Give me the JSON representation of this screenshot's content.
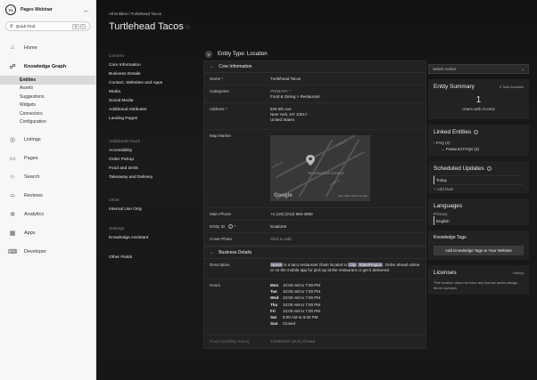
{
  "sidebar": {
    "brand": "Pages Webinar",
    "logo_text": "YX",
    "quick_find": {
      "label": "Quick Find",
      "keys": [
        "⌘",
        "K"
      ]
    },
    "nav": [
      {
        "label": "Home",
        "icon": "home-icon"
      },
      {
        "label": "Knowledge Graph",
        "icon": "graph-icon"
      },
      {
        "label": "Listings",
        "icon": "listings-icon"
      },
      {
        "label": "Pages",
        "icon": "pages-icon"
      },
      {
        "label": "Search",
        "icon": "search-icon"
      },
      {
        "label": "Reviews",
        "icon": "reviews-icon"
      },
      {
        "label": "Analytics",
        "icon": "analytics-icon"
      },
      {
        "label": "Apps",
        "icon": "apps-icon"
      },
      {
        "label": "Developer",
        "icon": "developer-icon"
      }
    ],
    "kg_sub": [
      "Entities",
      "Assets",
      "Suggestions",
      "Widgets",
      "Connectors",
      "Configuration"
    ]
  },
  "header": {
    "breadcrumb": "All Entities / Turtlehead Tacos",
    "title": "Turtlehead Tacos"
  },
  "sections": {
    "content_head": "Content",
    "content": [
      "Core Information",
      "Business Details",
      "Contact, Websites and Apps",
      "Media",
      "Social Media",
      "Additional Attributes",
      "Landing Pages"
    ],
    "hours_head": "Additional Hours",
    "hours": [
      "Accessibility",
      "Order Pickup",
      "Food and Drink",
      "Takeaway and Delivery"
    ],
    "other_head": "Other",
    "other": [
      "Internal Use Only"
    ],
    "settings_head": "Settings",
    "settings": [
      "Knowledge Assistant"
    ],
    "other_fields": "Other Fields"
  },
  "center": {
    "entity_type": "Entity Type: Location",
    "core_title": "Core Information",
    "name_label": "Name *",
    "name_value": "Turtlehead Tacos",
    "categories_label": "Categories",
    "categories_primary": "PRIMARY *",
    "categories_value": "Food & Dining > Restaurant",
    "address_label": "Address *",
    "address_lines": [
      "529 5th Ave",
      "New York, NY 10017",
      "United States"
    ],
    "map_label": "Map Marker",
    "map": {
      "place": "Wonderland Dreams",
      "google": "Google",
      "data": "Map data ©2022 Google",
      "street1": "E 46th St",
      "street2": "E 45th St",
      "street3": "E 44th St"
    },
    "phone_label": "Main Phone",
    "phone_value": "+1 (US) (212) 994-3900",
    "entity_id_label": "Entity ID",
    "entity_id_star": "*",
    "entity_id_value": "location5",
    "cover_label": "Cover Photo",
    "cover_value": "Click to add",
    "business_title": "Business Details",
    "desc_label": "Description",
    "desc": {
      "tag1": "Name",
      "p1": " is a taco restaurant chain located in ",
      "tag2": "City",
      "p2": " ",
      "tag3": "State/Region",
      "p3": ". Order ahead online or on the mobile app for pick up at the restaurant or get it delivered."
    },
    "hours_label": "Hours",
    "hours": [
      {
        "day": "Mon",
        "time": "10:00 AM to 7:00 PM"
      },
      {
        "day": "Tue",
        "time": "10:00 AM to 7:00 PM"
      },
      {
        "day": "Wed",
        "time": "10:00 AM to 7:00 PM"
      },
      {
        "day": "Thu",
        "time": "10:00 AM to 7:00 PM"
      },
      {
        "day": "Fri",
        "time": "10:00 AM to 7:00 PM"
      },
      {
        "day": "Sat",
        "time": "8:00 AM to 8:00 PM"
      },
      {
        "day": "Sun",
        "time": "Closed"
      }
    ],
    "holiday_label": "Hours (Holiday Hours)",
    "holiday_value": "12/25/2022 (Sun)    Closed"
  },
  "right": {
    "select_action": "Select Action",
    "summary_title": "Entity Summary",
    "summary_total": "0 Total Activities",
    "users_num": "1",
    "users_label": "Users with Access",
    "linked_title": "Linked Entities",
    "faq": "FAQ (2)",
    "faq_featured": "→ Featured FAQs (2)",
    "scheduled_title": "Scheduled Updates",
    "today": "Today",
    "add_date": "+ Add Date",
    "languages_title": "Languages",
    "primary": "Primary",
    "english": "English",
    "tags_title": "Knowledge Tags",
    "tags_button": "Add Knowledge Tags to Your Website",
    "licenses_title": "Licenses",
    "licenses_history": "History",
    "licenses_text": "This location does not have any license packs.Assign More Licenses"
  }
}
